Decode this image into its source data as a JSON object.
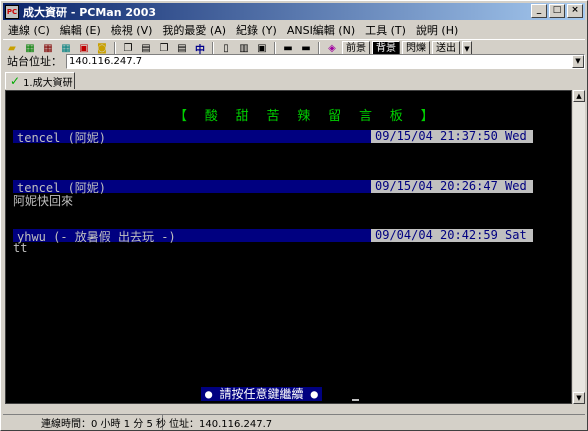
{
  "window": {
    "title": "成大資研 - PCMan 2003",
    "icon_text": "PC"
  },
  "menu": [
    "連線 (C)",
    "編輯 (E)",
    "檢視 (V)",
    "我的最愛 (A)",
    "紀錄 (Y)",
    "ANSI編輯 (N)",
    "工具 (T)",
    "說明 (H)"
  ],
  "toolbar": {
    "zhong": "中",
    "front_label": "前景",
    "back_label": "背景",
    "blink_label": "閃爍",
    "send_label": "送出"
  },
  "address": {
    "label": "站台位址：",
    "value": "140.116.247.7"
  },
  "tabs": [
    {
      "label": "1.成大資研"
    }
  ],
  "terminal": {
    "heading": "【 酸 甜 苦 辣 留 言 板 】",
    "entries": [
      {
        "who": "tencel (阿妮)",
        "when": "09/15/04 21:37:50 Wed",
        "message": ""
      },
      {
        "who": "tencel (阿妮)",
        "when": "09/15/04 20:26:47 Wed",
        "message": "阿妮快回來"
      },
      {
        "who": "yhwu (- 放暑假 出去玩 -)",
        "when": "09/04/04 20:42:59 Sat",
        "message": "tt"
      }
    ],
    "prompt": "● 請按任意鍵繼續 ●"
  },
  "status": {
    "connected_time": "連線時間：0 小時 1 分 5 秒",
    "address": "位址：140.116.247.7"
  },
  "colors": {
    "heading": "#00d000",
    "bar_bg": "#000080",
    "date_bg": "#c0c0c0"
  }
}
